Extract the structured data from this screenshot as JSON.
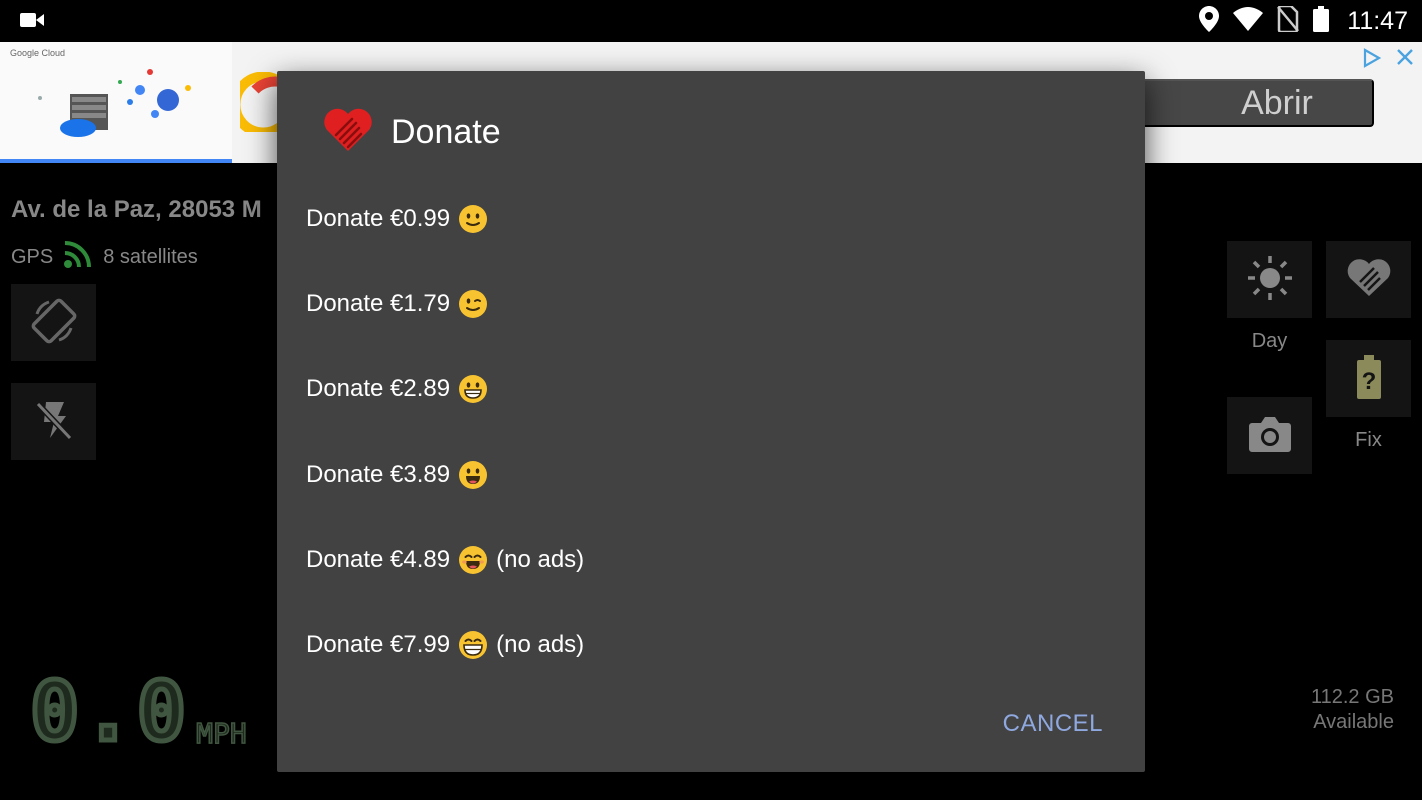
{
  "status_bar": {
    "time": "11:47",
    "icons": [
      "video-recording-icon",
      "location-icon",
      "wifi-icon",
      "no-sim-icon",
      "battery-icon"
    ]
  },
  "ad": {
    "brand": "Google Cloud",
    "open_label": "Abrir",
    "icons": [
      "adchoices-icon",
      "close-icon"
    ]
  },
  "app": {
    "address": "Av. de la Paz, 28053 M",
    "gps_label": "GPS",
    "satellites": "8 satellites",
    "day_label": "Day",
    "fix_label": "Fix",
    "speed": "0.0",
    "speed_unit": "MPH",
    "storage_size": "112.2 GB",
    "storage_label": "Available"
  },
  "dialog": {
    "title": "Donate",
    "options": [
      {
        "label": "Donate €0.99",
        "emoji": "slight-smile",
        "suffix": ""
      },
      {
        "label": "Donate €1.79",
        "emoji": "wink",
        "suffix": ""
      },
      {
        "label": "Donate €2.89",
        "emoji": "grin",
        "suffix": ""
      },
      {
        "label": "Donate €3.89",
        "emoji": "open-smile",
        "suffix": ""
      },
      {
        "label": "Donate €4.89",
        "emoji": "smile-eyes",
        "suffix": "(no ads)"
      },
      {
        "label": "Donate €7.99",
        "emoji": "big-grin",
        "suffix": "(no ads)"
      }
    ],
    "cancel_label": "CANCEL"
  },
  "colors": {
    "dialog_bg": "#424242",
    "accent": "#8fa8df",
    "heart": "#e02020",
    "gps_green": "#2e8b3a",
    "emoji_yellow": "#f7c331"
  }
}
